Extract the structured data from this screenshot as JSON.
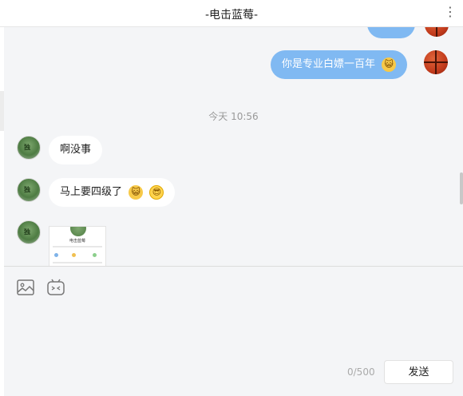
{
  "header": {
    "title": "-电击蓝莓-",
    "more_icon": "⋮"
  },
  "messages": {
    "out1": {
      "text": "你是专业白嫖一百年",
      "emoji": "cat-face"
    },
    "timestamp": "今天 10:56",
    "in1": {
      "text": "啊没事"
    },
    "in2": {
      "text": "马上要四级了",
      "emojis": [
        "cat-face",
        "smiling-face-with-sunglasses"
      ]
    },
    "card": {
      "title": "电击蓝莓"
    }
  },
  "composer": {
    "counter": "0/500",
    "send_label": "发送",
    "tools": [
      "image-icon",
      "emoji-icon"
    ]
  },
  "colors": {
    "outgoing_bubble": "#80b9f2",
    "incoming_bubble": "#ffffff",
    "background": "#f4f5f7"
  }
}
